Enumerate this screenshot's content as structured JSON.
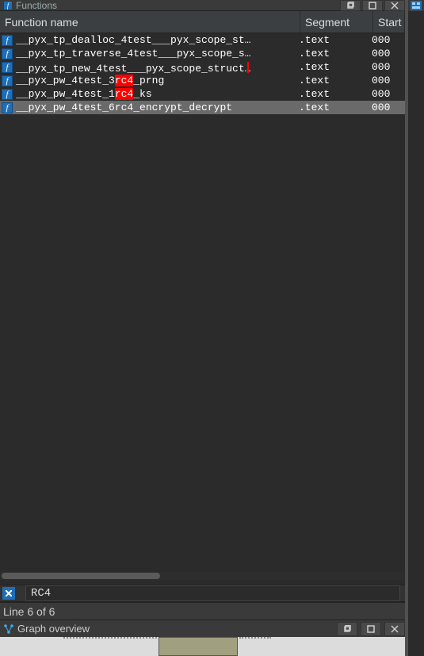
{
  "panel": {
    "title": "Functions",
    "next_panel_icon": "panel-icon"
  },
  "columns": {
    "name": "Function name",
    "segment": "Segment",
    "start": "Start"
  },
  "rows": [
    {
      "name_pre": "__pyx_tp_dealloc_4test___pyx_scope_st",
      "hi": "",
      "name_post": "",
      "trunc": true,
      "caret": false,
      "segment": ".text",
      "start": "000",
      "selected": false
    },
    {
      "name_pre": "__pyx_tp_traverse_4test___pyx_scope_s",
      "hi": "",
      "name_post": "",
      "trunc": true,
      "caret": false,
      "segment": ".text",
      "start": "000",
      "selected": false
    },
    {
      "name_pre": "__pyx_tp_new_4test___pyx_scope_struct",
      "hi": "",
      "name_post": "",
      "trunc": true,
      "caret": true,
      "segment": ".text",
      "start": "000",
      "selected": false
    },
    {
      "name_pre": "__pyx_pw_4test_3",
      "hi": "rc4",
      "name_post": "_prng",
      "trunc": false,
      "caret": false,
      "segment": ".text",
      "start": "000",
      "selected": false
    },
    {
      "name_pre": "__pyx_pw_4test_1",
      "hi": "rc4",
      "name_post": "_ks",
      "trunc": false,
      "caret": false,
      "segment": ".text",
      "start": "000",
      "selected": false
    },
    {
      "name_pre": "__pyx_pw_4test_6rc4_encrypt_decrypt",
      "hi": "",
      "name_post": "",
      "trunc": false,
      "caret": false,
      "segment": ".text",
      "start": "000",
      "selected": true
    }
  ],
  "search": {
    "value": "RC4"
  },
  "status": "Line 6 of 6",
  "graph_overview": {
    "title": "Graph overview"
  }
}
